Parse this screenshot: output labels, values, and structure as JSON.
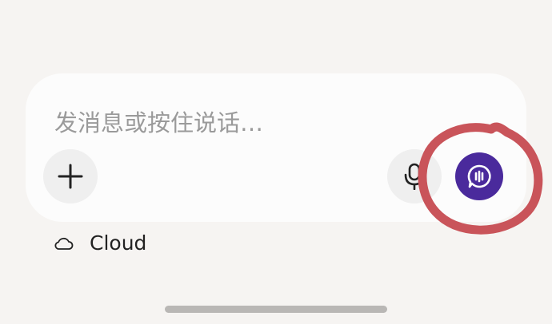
{
  "composer": {
    "placeholder": "发消息或按住说话…"
  },
  "icons": {
    "add": "plus-icon",
    "mic": "microphone-icon",
    "voice_chat": "voice-chat-bubble-icon",
    "cloud": "cloud-icon"
  },
  "colors": {
    "accent": "#4a2a9c",
    "annotation": "#c9545a",
    "background": "#f6f4f2"
  },
  "status_row": {
    "label": "Cloud"
  }
}
